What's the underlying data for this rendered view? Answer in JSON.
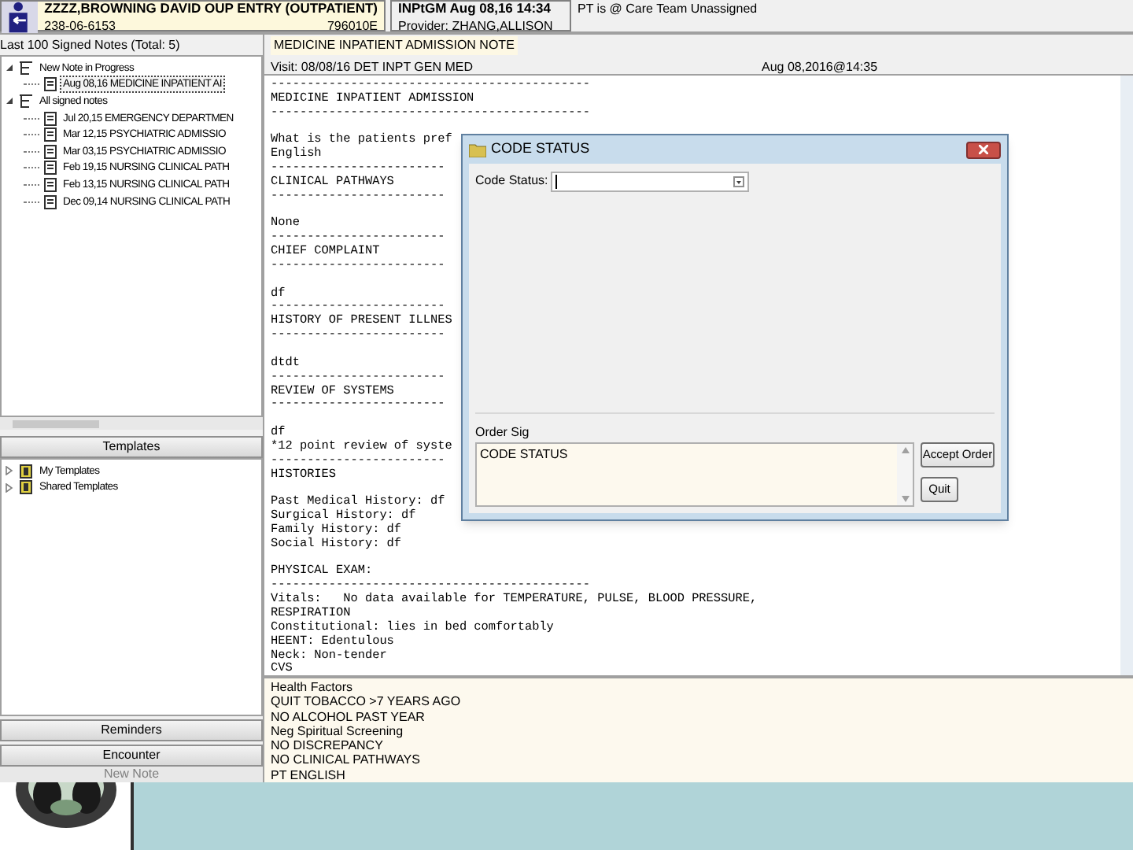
{
  "patient": {
    "name": "ZZZZ,BROWNING DAVID OUP ENTRY (OUTPATIENT)",
    "ssn": "238-06-6153",
    "code": "796010E"
  },
  "encounter": {
    "location": "INPtGM Aug 08,16 14:34",
    "provider": "Provider: ZHANG,ALLISON"
  },
  "care_team": "PT is @ Care Team Unassigned",
  "notes_panel": {
    "title": "Last 100 Signed Notes (Total: 5)",
    "tree": [
      {
        "label": "New Note in Progress",
        "expanded": true,
        "children": [
          {
            "label": "Aug 08,16 MEDICINE INPATIENT AI",
            "selected": true
          }
        ]
      },
      {
        "label": "All signed notes",
        "expanded": true,
        "children": [
          {
            "label": "Jul 20,15 EMERGENCY DEPARTMEN",
            "selected": false
          },
          {
            "label": "Mar 12,15 PSYCHIATRIC ADMISSIO",
            "selected": false
          },
          {
            "label": "Mar 03,15 PSYCHIATRIC ADMISSIO",
            "selected": false
          },
          {
            "label": "Feb 19,15 NURSING CLINICAL PATH",
            "selected": false
          },
          {
            "label": "Feb 13,15 NURSING CLINICAL PATH",
            "selected": false
          },
          {
            "label": "Dec 09,14 NURSING CLINICAL PATH",
            "selected": false
          }
        ]
      }
    ]
  },
  "templates": {
    "title": "Templates",
    "tree": [
      {
        "label": "My Templates",
        "expanded": false
      },
      {
        "label": "Shared Templates",
        "expanded": false
      }
    ]
  },
  "side_buttons": [
    "Reminders",
    "Encounter"
  ],
  "new_note_button": "New Note",
  "note": {
    "title": "MEDICINE INPATIENT ADMISSION NOTE",
    "visit": "Visit: 08/08/16 DET INPT GEN MED",
    "date": "Aug 08,2016@14:35",
    "blocks": [
      [
        "--------------------------------------------",
        "MEDICINE INPATIENT ADMISSION",
        "--------------------------------------------"
      ],
      [
        "What is the patients pref",
        "English",
        "------------------------",
        "CLINICAL PATHWAYS",
        "------------------------"
      ],
      [
        "None",
        "------------------------",
        "CHIEF COMPLAINT",
        "------------------------"
      ],
      [
        "df",
        "------------------------",
        "HISTORY OF PRESENT ILLNES",
        "------------------------"
      ],
      [
        "dtdt",
        "------------------------",
        "REVIEW OF SYSTEMS",
        "------------------------"
      ],
      [
        "df",
        "*12 point review of syste",
        "------------------------",
        "HISTORIES"
      ],
      [
        "Past Medical History: df",
        "Surgical History: df",
        "Family History: df",
        "Social History: df"
      ],
      [
        "PHYSICAL EXAM:",
        "--------------------------------------------",
        "Vitals:   No data available for TEMPERATURE, PULSE, BLOOD PRESSURE,",
        "RESPIRATION",
        "Constitutional: lies in bed comfortably",
        "HEENT: Edentulous",
        "Neck: Non-tender",
        "CVS"
      ]
    ]
  },
  "reminders": [
    "Health Factors",
    "QUIT TOBACCO >7 YEARS AGO",
    "NO ALCOHOL PAST YEAR",
    "Neg Spiritual Screening",
    "NO DISCREPANCY",
    "NO CLINICAL PATHWAYS",
    "PT ENGLISH"
  ],
  "dialog": {
    "title": "CODE STATUS",
    "field_label": "Code Status:",
    "order_sig_label": "Order Sig",
    "order_sig": "CODE STATUS",
    "buttons": [
      "Accept Order",
      "Quit"
    ]
  }
}
